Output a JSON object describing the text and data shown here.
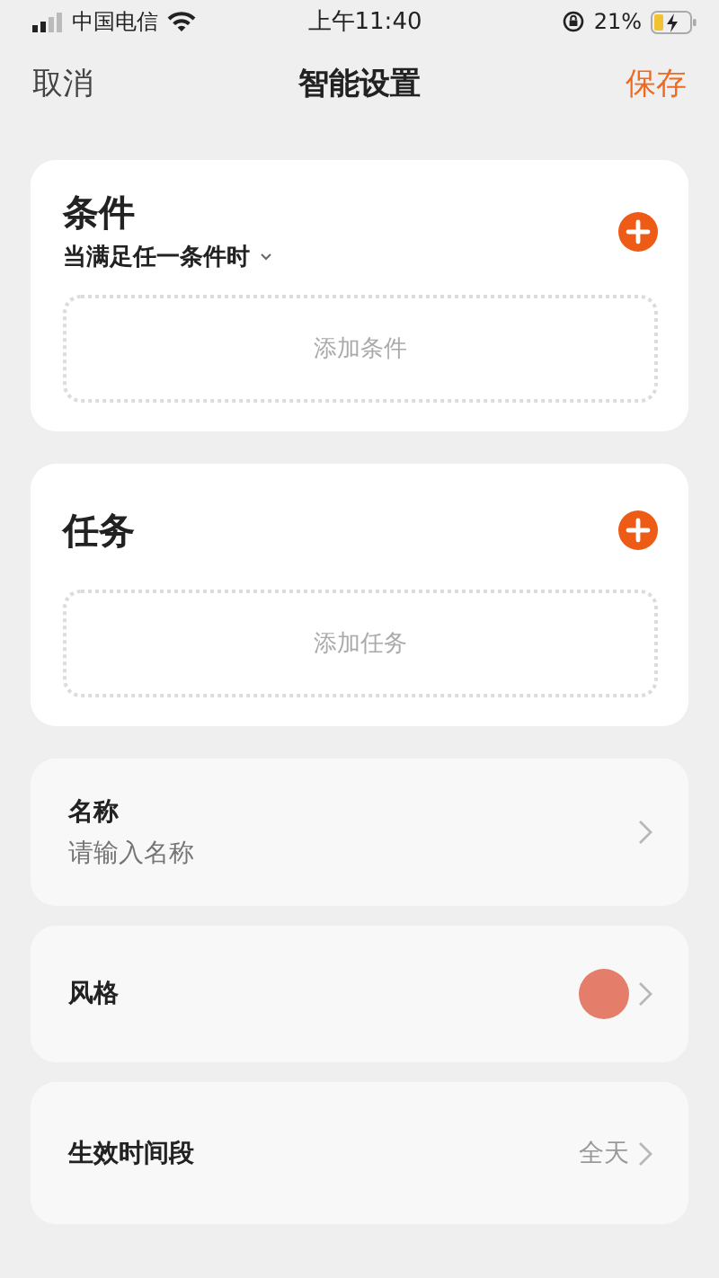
{
  "status_bar": {
    "carrier": "中国电信",
    "time": "上午11:40",
    "battery": "21%"
  },
  "nav": {
    "cancel": "取消",
    "title": "智能设置",
    "save": "保存"
  },
  "sections": [
    {
      "title": "条件",
      "subtitle": "当满足任一条件时",
      "add_label": "添加条件"
    },
    {
      "title": "任务",
      "add_label": "添加任务"
    }
  ],
  "settings": [
    {
      "kind": "input",
      "label": "名称",
      "placeholder": "请输入名称"
    },
    {
      "kind": "color",
      "label": "风格",
      "color": "#e47d6a"
    },
    {
      "kind": "value",
      "label": "生效时间段",
      "value": "全天"
    }
  ]
}
